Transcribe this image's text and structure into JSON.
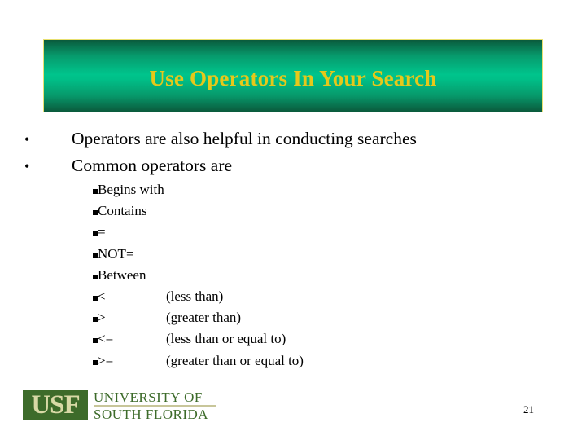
{
  "slide": {
    "title": "Use Operators In Your Search",
    "bullets": [
      "Operators are also helpful in conducting searches",
      "Common operators are"
    ],
    "operators": [
      {
        "op": "Begins with",
        "desc": ""
      },
      {
        "op": "Contains",
        "desc": ""
      },
      {
        "op": "=",
        "desc": ""
      },
      {
        "op": "NOT=",
        "desc": ""
      },
      {
        "op": "Between",
        "desc": ""
      },
      {
        "op": "<",
        "desc": "(less than)"
      },
      {
        "op": ">",
        "desc": "(greater than)"
      },
      {
        "op": "<=",
        "desc": "(less than or equal to)"
      },
      {
        "op": ">=",
        "desc": "(greater than or equal to)"
      }
    ],
    "page_number": "21"
  },
  "logo": {
    "mark": "USF",
    "line1": "UNIVERSITY OF",
    "line2": "SOUTH FLORIDA"
  },
  "colors": {
    "title_text": "#e6c81a",
    "banner_green": "#00c48c",
    "logo_green": "#3d6b2a"
  }
}
